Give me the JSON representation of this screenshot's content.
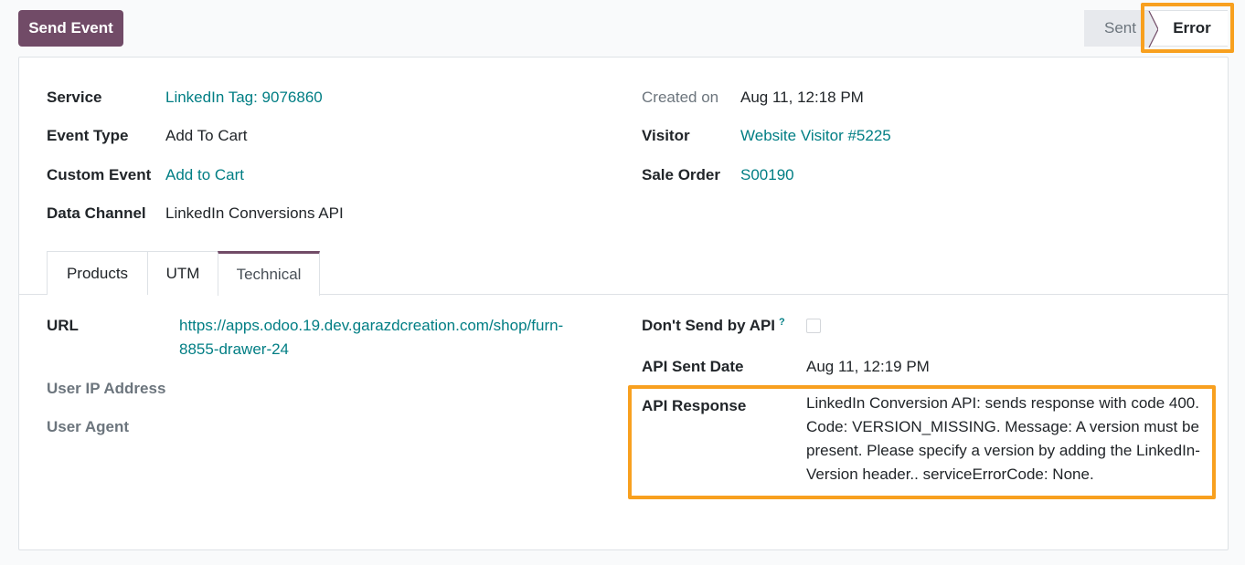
{
  "header": {
    "send_button": "Send Event",
    "status": {
      "sent": "Sent",
      "error": "Error"
    }
  },
  "fields_left": [
    {
      "label": "Service",
      "value": "LinkedIn Tag: 9076860"
    },
    {
      "label": "Event Type",
      "value": "Add To Cart"
    },
    {
      "label": "Custom Event",
      "value": "Add to Cart"
    },
    {
      "label": "Data Channel",
      "value": "LinkedIn Conversions API"
    }
  ],
  "fields_right": [
    {
      "label": "Created on",
      "value": "Aug 11, 12:18 PM"
    },
    {
      "label": "Visitor",
      "value": "Website Visitor #5225"
    },
    {
      "label": "Sale Order",
      "value": "S00190"
    }
  ],
  "tabs": [
    {
      "label": "Products"
    },
    {
      "label": "UTM"
    },
    {
      "label": "Technical"
    }
  ],
  "technical": {
    "url_label": "URL",
    "url_value": "https://apps.odoo.19.dev.garazdcreation.com/shop/furn-8855-drawer-24",
    "user_ip_label": "User IP Address",
    "user_agent_label": "User Agent",
    "dont_send_label": "Don't Send by API",
    "help_mark": "?",
    "api_sent_date_label": "API Sent Date",
    "api_sent_date_value": "Aug 11, 12:19 PM",
    "api_response_label": "API Response",
    "api_response_value": "LinkedIn Conversion API: sends response with code 400. Code: VERSION_MISSING. Message: A version must be present. Please specify a version by adding the LinkedIn-Version header.. serviceErrorCode: None."
  },
  "colors": {
    "primary": "#714b67",
    "link": "#017e84",
    "highlight": "#f8a01f"
  }
}
